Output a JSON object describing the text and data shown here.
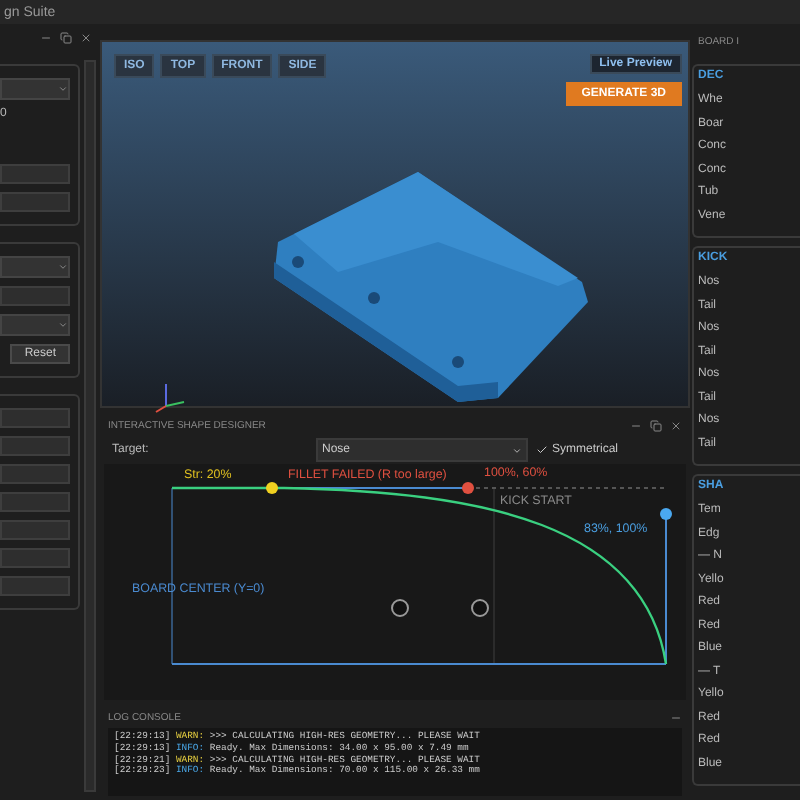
{
  "window": {
    "title": "gn Suite"
  },
  "left_panel": {
    "groups": [
      {
        "items": [
          {
            "kind": "dropdown"
          },
          {
            "kind": "text",
            "label": "0"
          },
          {
            "kind": "spin"
          },
          {
            "kind": "spin"
          }
        ]
      },
      {
        "items": [
          {
            "kind": "dropdown"
          },
          {
            "kind": "spin"
          },
          {
            "kind": "dropdown"
          },
          {
            "kind": "button",
            "label": "Reset"
          }
        ]
      },
      {
        "items": [
          {
            "kind": "spin"
          },
          {
            "kind": "spin"
          },
          {
            "kind": "spin"
          },
          {
            "kind": "spin"
          },
          {
            "kind": "spin"
          },
          {
            "kind": "spin"
          },
          {
            "kind": "spin"
          }
        ]
      }
    ]
  },
  "viewport": {
    "view_buttons": [
      "ISO",
      "TOP",
      "FRONT",
      "SIDE"
    ],
    "badge": "Live Preview",
    "action": "GENERATE 3D"
  },
  "designer": {
    "title": "INTERACTIVE SHAPE DESIGNER",
    "target_label": "Target:",
    "target": "Nose",
    "symmetrical": {
      "label": "Symmetrical",
      "checked": true
    },
    "labels": [
      {
        "text": "Str: 20%",
        "color": "#e0c020"
      },
      {
        "text": "FILLET FAILED (R too large)",
        "color": "#e05040"
      },
      {
        "text": "100%, 60%",
        "color": "#e05040"
      },
      {
        "text": "KICK START",
        "color": "#8a8a8a"
      },
      {
        "text": "83%, 100%",
        "color": "#4a9ee0"
      },
      {
        "text": "BOARD CENTER (Y=0)",
        "color": "#4a8ad0"
      }
    ]
  },
  "log": {
    "title": "LOG CONSOLE",
    "lines": [
      {
        "time": "[22:29:13]",
        "kind": "warn",
        "level": "WARN:",
        "message": ">>> CALCULATING HIGH-RES GEOMETRY... PLEASE WAIT"
      },
      {
        "time": "[22:29:13]",
        "kind": "info",
        "level": "INFO:",
        "message": "Ready. Max Dimensions: 34.00 x 95.00 x 7.49 mm"
      },
      {
        "time": "[22:29:21]",
        "kind": "warn",
        "level": "WARN:",
        "message": ">>> CALCULATING HIGH-RES GEOMETRY... PLEASE WAIT"
      },
      {
        "time": "[22:29:23]",
        "kind": "info",
        "level": "INFO:",
        "message": "Ready. Max Dimensions: 70.00 x 115.00 x 26.33 mm"
      }
    ]
  },
  "right_panel": {
    "title": "BOARD I",
    "groups": [
      {
        "title": "DEC",
        "items": [
          "Whe",
          "Boar",
          "Conc",
          "Conc",
          "Tub",
          "Vene"
        ]
      },
      {
        "title": "KICK",
        "items": [
          "Nos",
          "Tail",
          "Nos",
          "Tail",
          "Nos",
          "Tail",
          "Nos",
          "Tail"
        ]
      },
      {
        "title": "SHA",
        "items": [
          "Tem",
          "Edg",
          "— N",
          "Yello",
          "Red",
          "Red",
          "Blue",
          "— T",
          "Yello",
          "Red",
          "Red",
          "Blue"
        ]
      }
    ]
  }
}
